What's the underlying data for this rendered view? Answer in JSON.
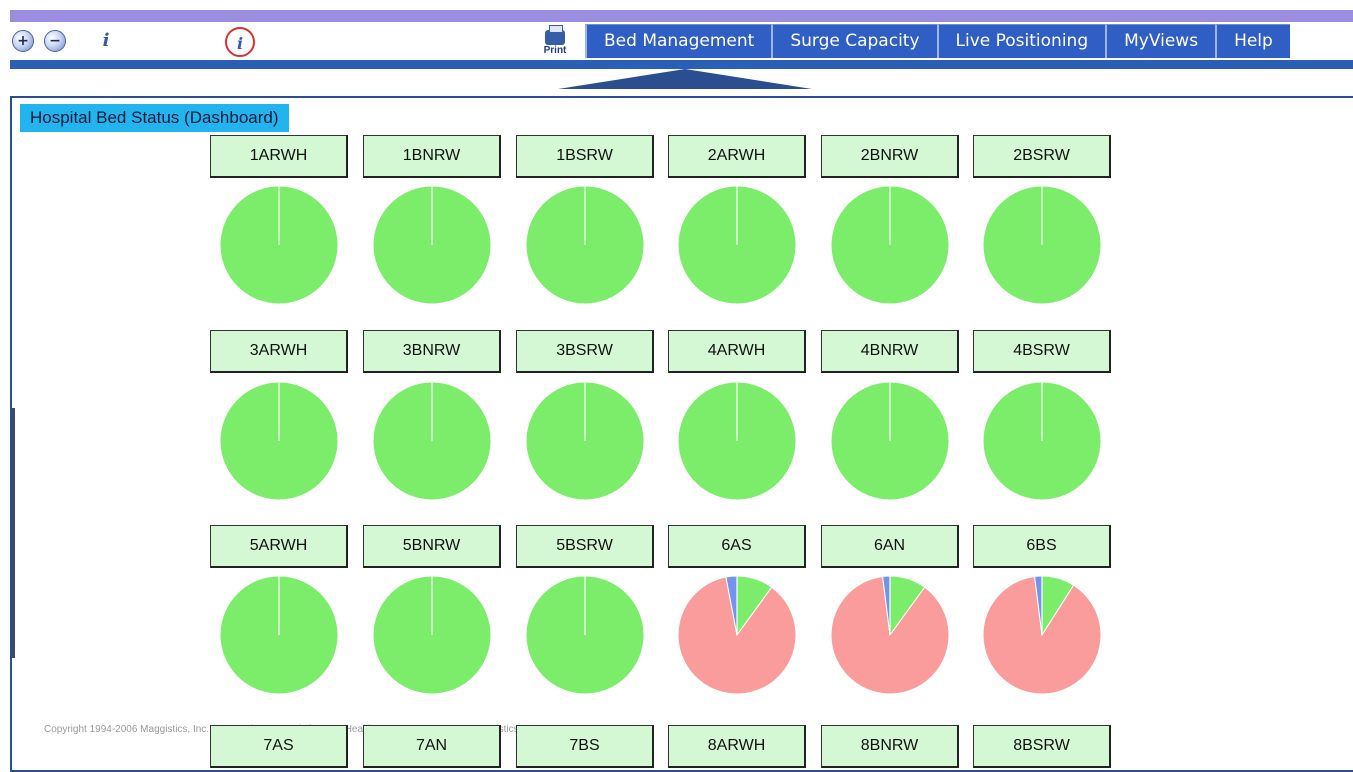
{
  "toolbar": {
    "print_label": "Print",
    "tabs": [
      {
        "label": "Bed Management"
      },
      {
        "label": "Surge Capacity"
      },
      {
        "label": "Live Positioning"
      },
      {
        "label": "MyViews"
      },
      {
        "label": "Help"
      }
    ]
  },
  "panel": {
    "title": "Hospital Bed Status (Dashboard)"
  },
  "colors": {
    "available": "#7ced6b",
    "occupied": "#fb9c9c",
    "other": "#7393ec",
    "accent": "#2f5ec4",
    "title_bg": "#21b4ef"
  },
  "icons": [
    "zoom-in-icon",
    "zoom-out-icon",
    "identify-icon",
    "identify-selected-icon",
    "printer-icon"
  ],
  "wards": [
    {
      "name": "1ARWH"
    },
    {
      "name": "1BNRW"
    },
    {
      "name": "1BSRW"
    },
    {
      "name": "2ARWH"
    },
    {
      "name": "2BNRW"
    },
    {
      "name": "2BSRW"
    },
    {
      "name": "3ARWH"
    },
    {
      "name": "3BNRW"
    },
    {
      "name": "3BSRW"
    },
    {
      "name": "4ARWH"
    },
    {
      "name": "4BNRW"
    },
    {
      "name": "4BSRW"
    },
    {
      "name": "5ARWH"
    },
    {
      "name": "5BNRW"
    },
    {
      "name": "5BSRW"
    },
    {
      "name": "6AS"
    },
    {
      "name": "6AN"
    },
    {
      "name": "6BS"
    },
    {
      "name": "7AS"
    },
    {
      "name": "7AN"
    },
    {
      "name": "7BS"
    },
    {
      "name": "8ARWH"
    },
    {
      "name": "8BNRW"
    },
    {
      "name": "8BSRW"
    }
  ],
  "chart_data": [
    {
      "type": "pie",
      "title": "1ARWH",
      "slices": [
        {
          "label": "available",
          "value": 100
        }
      ]
    },
    {
      "type": "pie",
      "title": "1BNRW",
      "slices": [
        {
          "label": "available",
          "value": 100
        }
      ]
    },
    {
      "type": "pie",
      "title": "1BSRW",
      "slices": [
        {
          "label": "available",
          "value": 100
        }
      ]
    },
    {
      "type": "pie",
      "title": "2ARWH",
      "slices": [
        {
          "label": "available",
          "value": 100
        }
      ]
    },
    {
      "type": "pie",
      "title": "2BNRW",
      "slices": [
        {
          "label": "available",
          "value": 100
        }
      ]
    },
    {
      "type": "pie",
      "title": "2BSRW",
      "slices": [
        {
          "label": "available",
          "value": 100
        }
      ]
    },
    {
      "type": "pie",
      "title": "3ARWH",
      "slices": [
        {
          "label": "available",
          "value": 100
        }
      ]
    },
    {
      "type": "pie",
      "title": "3BNRW",
      "slices": [
        {
          "label": "available",
          "value": 100
        }
      ]
    },
    {
      "type": "pie",
      "title": "3BSRW",
      "slices": [
        {
          "label": "available",
          "value": 100
        }
      ]
    },
    {
      "type": "pie",
      "title": "4ARWH",
      "slices": [
        {
          "label": "available",
          "value": 100
        }
      ]
    },
    {
      "type": "pie",
      "title": "4BNRW",
      "slices": [
        {
          "label": "available",
          "value": 100
        }
      ]
    },
    {
      "type": "pie",
      "title": "4BSRW",
      "slices": [
        {
          "label": "available",
          "value": 100
        }
      ]
    },
    {
      "type": "pie",
      "title": "5ARWH",
      "slices": [
        {
          "label": "available",
          "value": 100
        }
      ]
    },
    {
      "type": "pie",
      "title": "5BNRW",
      "slices": [
        {
          "label": "available",
          "value": 100
        }
      ]
    },
    {
      "type": "pie",
      "title": "5BSRW",
      "slices": [
        {
          "label": "available",
          "value": 100
        }
      ]
    },
    {
      "type": "pie",
      "title": "6AS",
      "slices": [
        {
          "label": "available",
          "value": 10
        },
        {
          "label": "occupied",
          "value": 87
        },
        {
          "label": "other",
          "value": 3
        }
      ]
    },
    {
      "type": "pie",
      "title": "6AN",
      "slices": [
        {
          "label": "available",
          "value": 10
        },
        {
          "label": "occupied",
          "value": 88
        },
        {
          "label": "other",
          "value": 2
        }
      ]
    },
    {
      "type": "pie",
      "title": "6BS",
      "slices": [
        {
          "label": "available",
          "value": 9
        },
        {
          "label": "occupied",
          "value": 89
        },
        {
          "label": "other",
          "value": 2
        }
      ]
    }
  ],
  "footer": {
    "copyright": "Copyright 1994-2006 Maggistics, Inc. - Enterprise GIS Solutions - A Healthcare Company - www.maggistics.com"
  }
}
